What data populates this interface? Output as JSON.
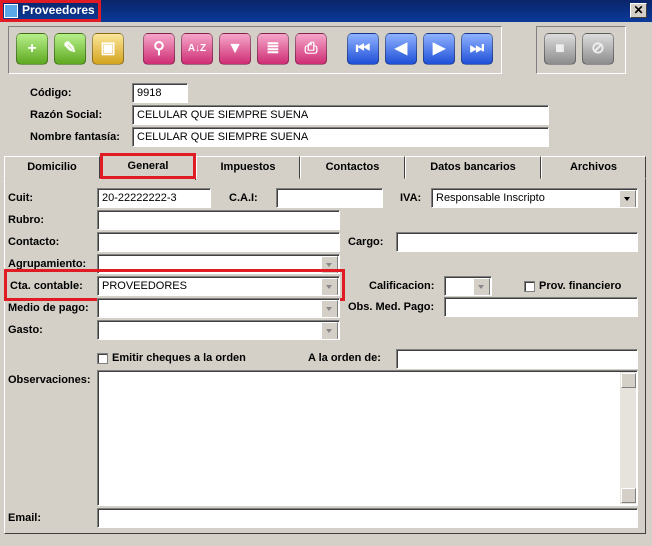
{
  "window": {
    "title": "Proveedores",
    "close": "✕"
  },
  "toolbar": {
    "add": "+",
    "edit": "✎",
    "copy": "▣",
    "search": "⚲",
    "sort": "A↓Z",
    "filter": "▼",
    "report": "≣",
    "print": "⎙",
    "first": "⏮",
    "prev": "◀",
    "next": "▶",
    "last": "⏭",
    "save": "■",
    "cancel": "⊘"
  },
  "header": {
    "codigo_label": "Código:",
    "codigo": "9918",
    "razon_label": "Razón Social:",
    "razon": "CELULAR QUE SIEMPRE SUENA",
    "fantasia_label": "Nombre fantasía:",
    "fantasia": "CELULAR QUE SIEMPRE SUENA"
  },
  "tabs": [
    "Domicilio",
    "General",
    "Impuestos",
    "Contactos",
    "Datos bancarios",
    "Archivos"
  ],
  "general": {
    "cuit_label": "Cuit:",
    "cuit": "20-22222222-3",
    "cai_label": "C.A.I:",
    "cai": "",
    "iva_label": "IVA:",
    "iva": "Responsable Inscripto",
    "rubro_label": "Rubro:",
    "rubro": "",
    "contacto_label": "Contacto:",
    "contacto": "",
    "cargo_label": "Cargo:",
    "cargo": "",
    "agrupamiento_label": "Agrupamiento:",
    "agrupamiento": "",
    "cta_label": "Cta. contable:",
    "cta": "PROVEEDORES",
    "calificacion_label": "Calificacion:",
    "calificacion": "",
    "prov_fin_label": "Prov. financiero",
    "medio_label": "Medio de pago:",
    "medio": "",
    "obs_med_label": "Obs. Med. Pago:",
    "obs_med": "",
    "gasto_label": "Gasto:",
    "gasto": "",
    "emitir_label": "Emitir cheques a la orden",
    "orden_label": "A la orden de:",
    "orden": "",
    "observaciones_label": "Observaciones:",
    "observaciones": "",
    "email_label": "Email:",
    "email": ""
  },
  "colors": {
    "highlight": "#e01b24",
    "titlebar": "#0a246a"
  }
}
